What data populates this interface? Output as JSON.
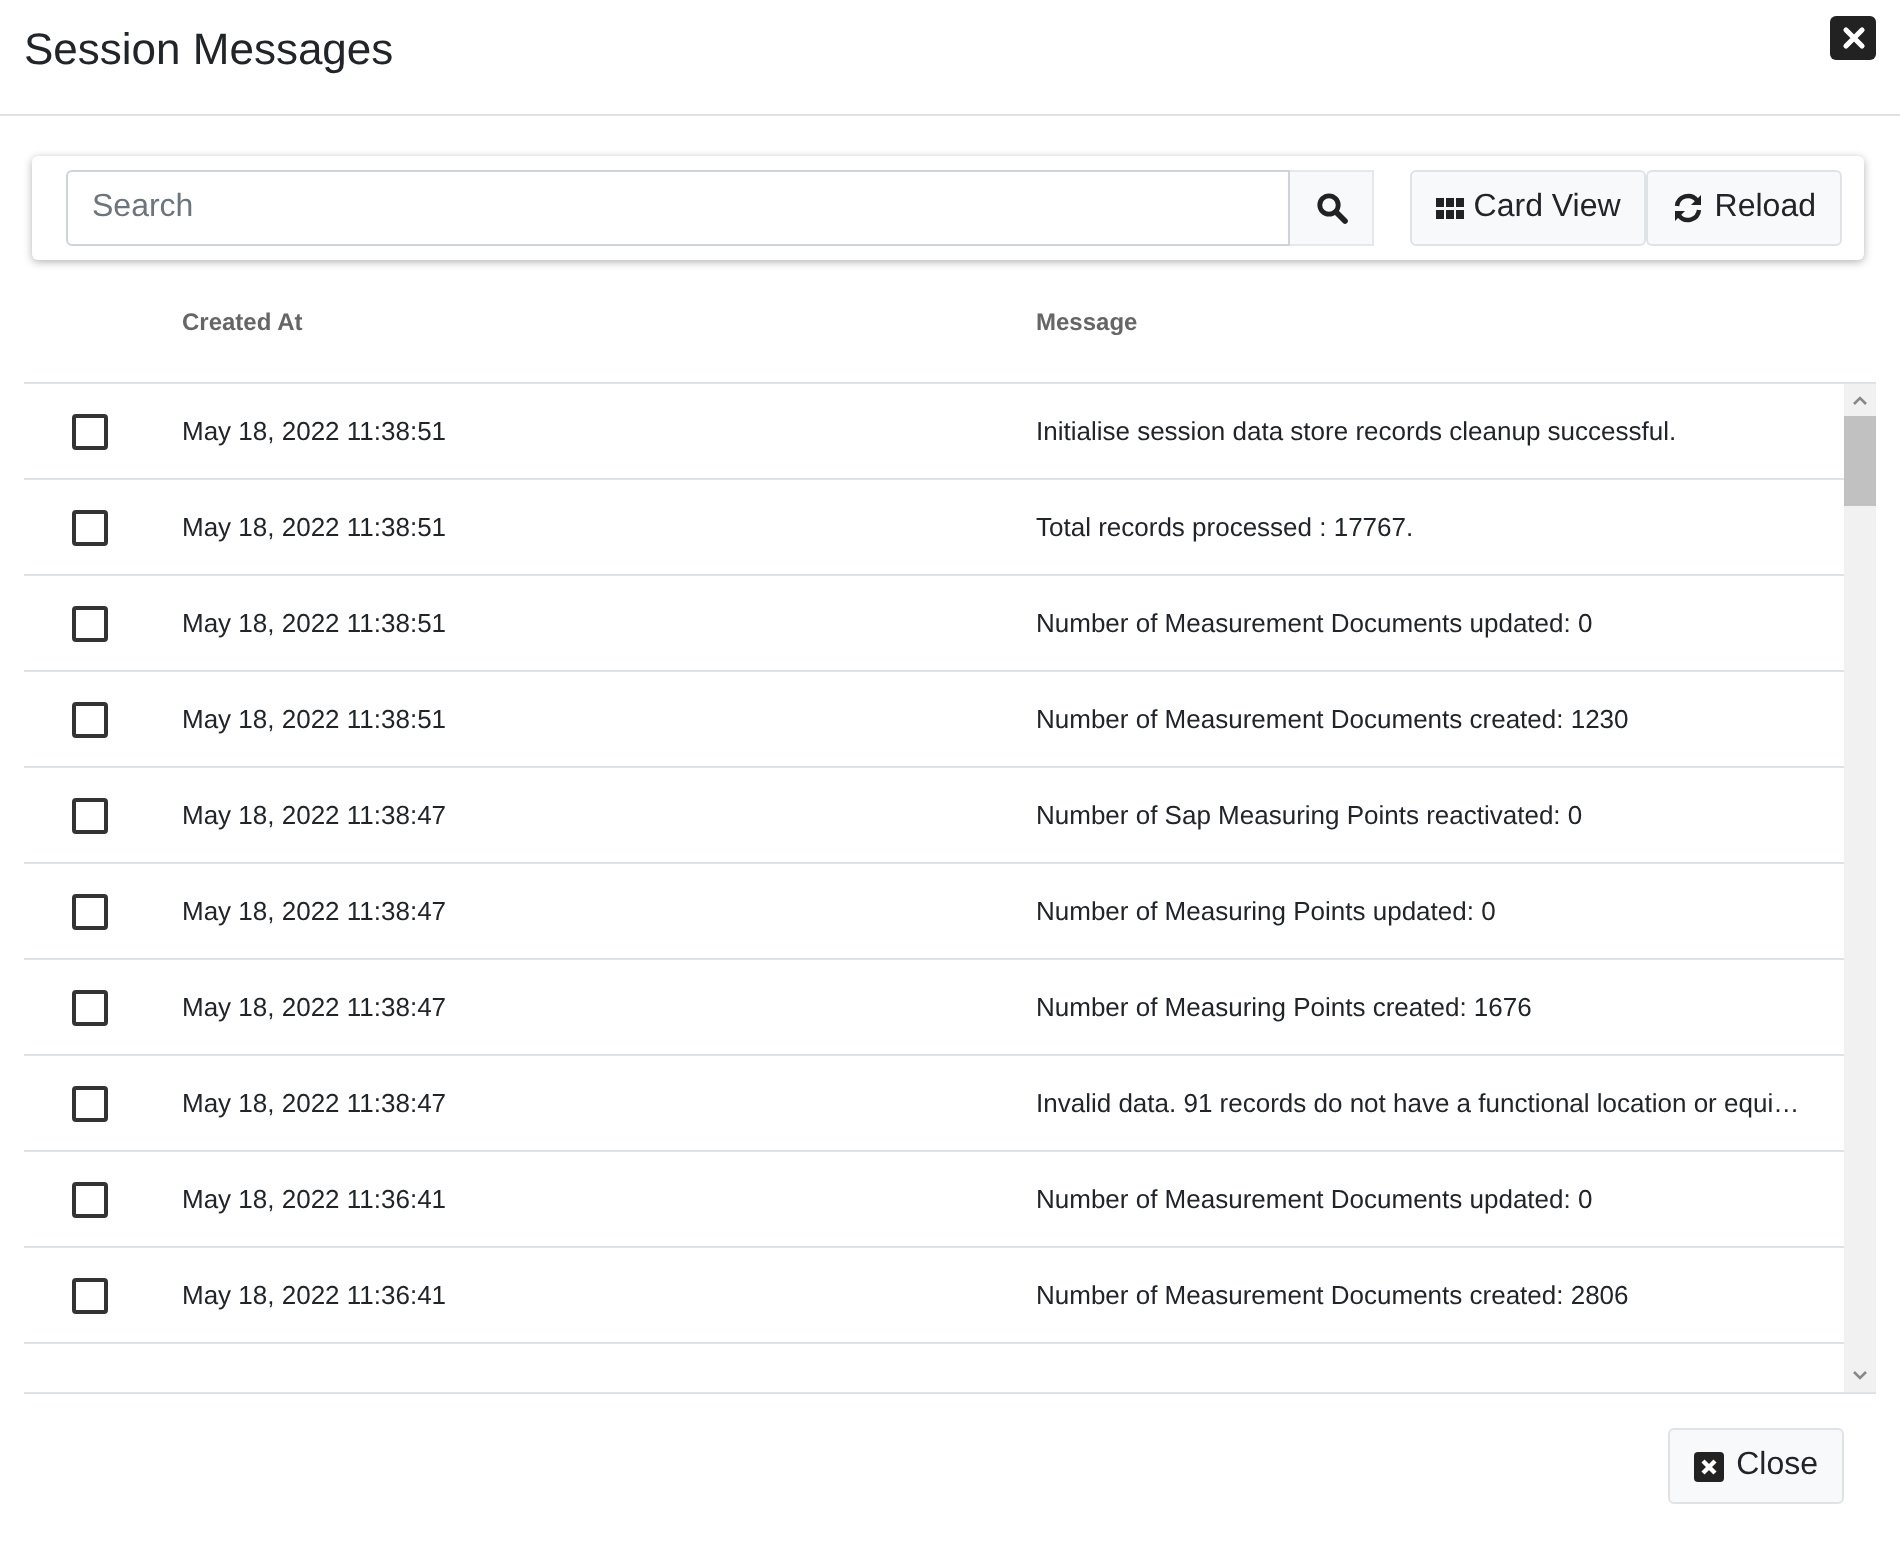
{
  "dialog": {
    "title": "Session Messages"
  },
  "toolbar": {
    "search": {
      "placeholder": "Search"
    },
    "buttons": [
      {
        "kind": "cards",
        "label": "Card View"
      },
      {
        "kind": "reload",
        "label": "Reload"
      }
    ]
  },
  "table": {
    "columns": [
      "Created At",
      "Message"
    ],
    "rows": [
      {
        "checked": false,
        "created_at": "May 18, 2022 11:38:51",
        "message": "Initialise session data store records cleanup successful."
      },
      {
        "checked": false,
        "created_at": "May 18, 2022 11:38:51",
        "message": "Total records processed : 17767."
      },
      {
        "checked": false,
        "created_at": "May 18, 2022 11:38:51",
        "message": "Number of Measurement Documents updated: 0"
      },
      {
        "checked": false,
        "created_at": "May 18, 2022 11:38:51",
        "message": "Number of Measurement Documents created: 1230"
      },
      {
        "checked": false,
        "created_at": "May 18, 2022 11:38:47",
        "message": "Number of Sap Measuring Points reactivated: 0"
      },
      {
        "checked": false,
        "created_at": "May 18, 2022 11:38:47",
        "message": "Number of Measuring Points updated: 0"
      },
      {
        "checked": false,
        "created_at": "May 18, 2022 11:38:47",
        "message": "Number of Measuring Points created: 1676"
      },
      {
        "checked": false,
        "created_at": "May 18, 2022 11:38:47",
        "message": "Invalid data. 91 records do not have a functional location or equi…"
      },
      {
        "checked": false,
        "created_at": "May 18, 2022 11:36:41",
        "message": "Number of Measurement Documents updated: 0"
      },
      {
        "checked": false,
        "created_at": "May 18, 2022 11:36:41",
        "message": "Number of Measurement Documents created: 2806"
      }
    ]
  },
  "footer": {
    "close_label": "Close"
  }
}
